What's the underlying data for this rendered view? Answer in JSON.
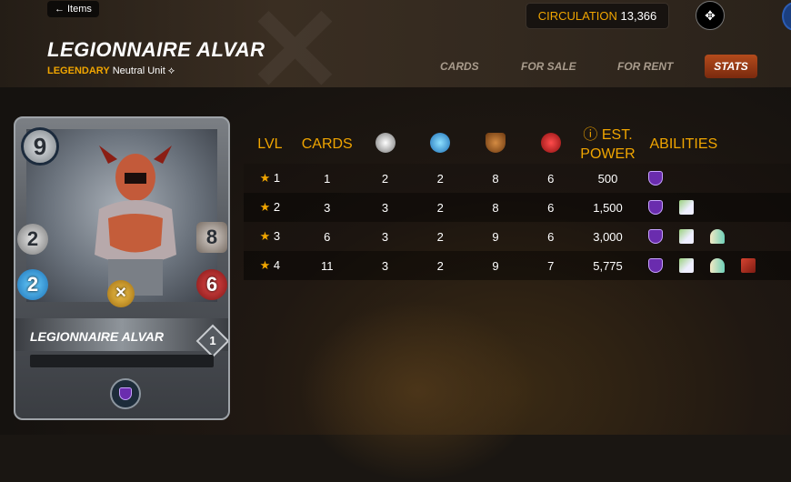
{
  "header": {
    "back_label": "Items",
    "card_title": "LEGIONNAIRE ALVAR",
    "rarity": "LEGENDARY",
    "unit_type": "Neutral Unit",
    "circulation_label": "CIRCULATION",
    "circulation_value": "13,366"
  },
  "tabs": {
    "cards": "CARDS",
    "for_sale": "FOR SALE",
    "for_rent": "FOR RENT",
    "stats": "STATS"
  },
  "card": {
    "mana": "9",
    "melee": "2",
    "magic": "2",
    "armor": "8",
    "health": "6",
    "name": "LEGIONNAIRE ALVAR",
    "level": "1"
  },
  "table": {
    "headers": {
      "lvl": "LVL",
      "cards": "CARDS",
      "est_power_line1": "EST.",
      "est_power_line2": "POWER",
      "abilities": "ABILITIES"
    },
    "rows": [
      {
        "lvl": "1",
        "cards": "1",
        "melee": "2",
        "magic": "2",
        "armor": "8",
        "health": "6",
        "power": "500"
      },
      {
        "lvl": "2",
        "cards": "3",
        "melee": "3",
        "magic": "2",
        "armor": "8",
        "health": "6",
        "power": "1,500"
      },
      {
        "lvl": "3",
        "cards": "6",
        "melee": "3",
        "magic": "2",
        "armor": "9",
        "health": "6",
        "power": "3,000"
      },
      {
        "lvl": "4",
        "cards": "11",
        "melee": "3",
        "magic": "2",
        "armor": "9",
        "health": "7",
        "power": "5,775"
      }
    ]
  },
  "colors": {
    "accent": "#f0a500",
    "stats_tab": "#b34b1c"
  }
}
